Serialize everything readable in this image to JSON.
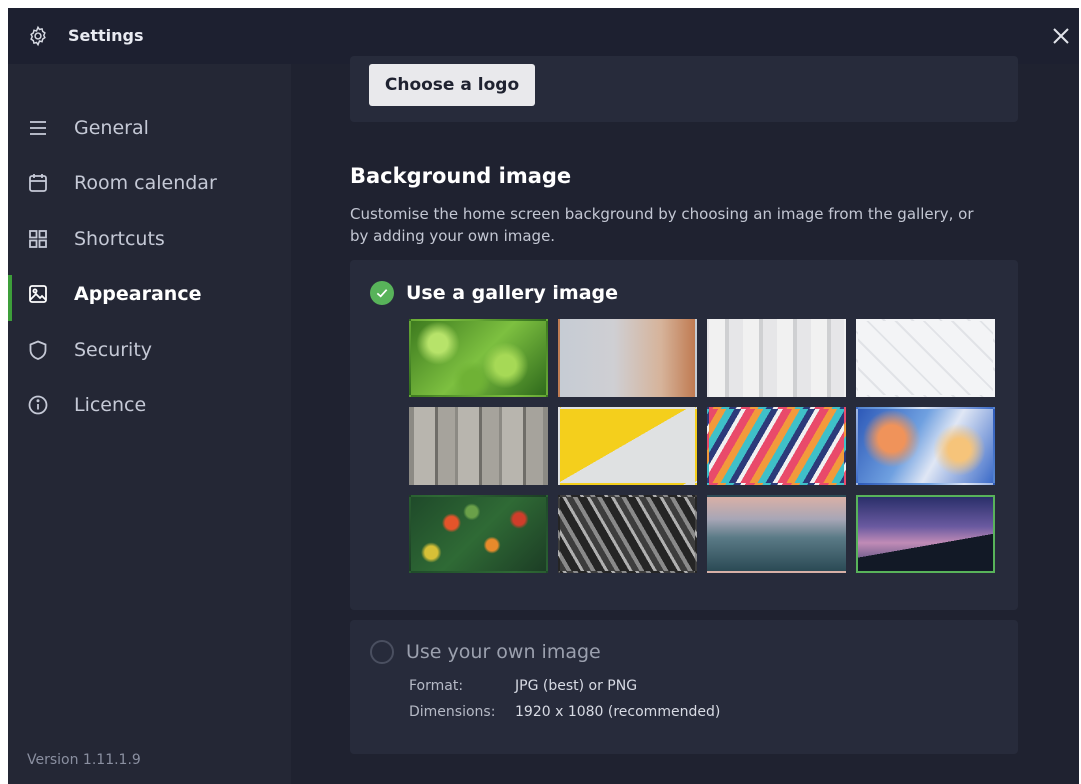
{
  "window": {
    "title": "Settings",
    "close_symbol": "×"
  },
  "sidebar": {
    "items": [
      {
        "label": "General",
        "icon": "list-icon",
        "active": false
      },
      {
        "label": "Room calendar",
        "icon": "calendar-icon",
        "active": false
      },
      {
        "label": "Shortcuts",
        "icon": "grid-icon",
        "active": false
      },
      {
        "label": "Appearance",
        "icon": "image-icon",
        "active": true
      },
      {
        "label": "Security",
        "icon": "shield-icon",
        "active": false
      },
      {
        "label": "Licence",
        "icon": "info-icon",
        "active": false
      }
    ],
    "version": "Version 1.11.1.9"
  },
  "logo": {
    "button_label": "Choose a logo"
  },
  "background": {
    "title": "Background image",
    "description": "Customise the home screen background by choosing an image from the gallery, or by adding your own image.",
    "gallery_option_label": "Use a gallery image",
    "gallery_selected": true,
    "thumbnails": [
      {
        "name": "green-leaves-thumbnail"
      },
      {
        "name": "blurred-gradient-thumbnail"
      },
      {
        "name": "white-building-thumbnail"
      },
      {
        "name": "white-tiles-thumbnail"
      },
      {
        "name": "wooden-planks-thumbnail"
      },
      {
        "name": "yellow-grey-wall-thumbnail"
      },
      {
        "name": "colorful-paint-swirl-thumbnail"
      },
      {
        "name": "abstract-blue-orange-thumbnail"
      },
      {
        "name": "flower-field-thumbnail"
      },
      {
        "name": "city-aerial-bw-thumbnail"
      },
      {
        "name": "sea-sunset-thumbnail"
      },
      {
        "name": "mountains-night-sky-thumbnail"
      }
    ],
    "selected_thumbnail_index": 11,
    "own_option_label": "Use your own image",
    "own_selected": false,
    "format_label": "Format:",
    "format_value": "JPG (best) or PNG",
    "dimensions_label": "Dimensions:",
    "dimensions_value": "1920 x 1080 (recommended)"
  },
  "colors": {
    "accent": "#58b35a",
    "active_bar": "#3d9e3a",
    "window_bg": "#232635",
    "content_bg": "#1f2230",
    "card_bg": "#272b3b"
  }
}
